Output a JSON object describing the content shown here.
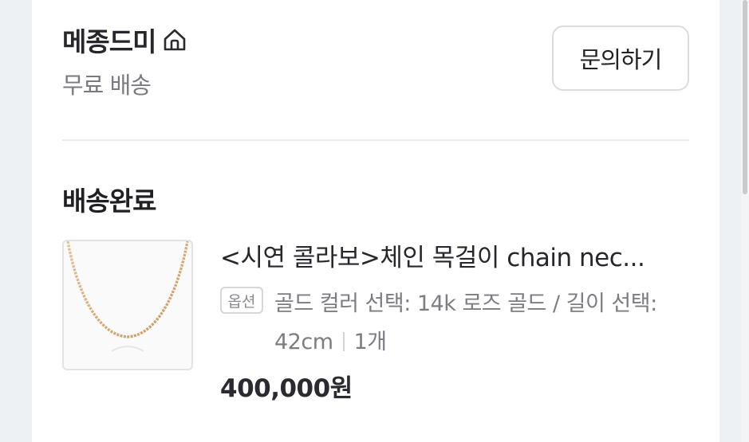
{
  "store": {
    "name": "메종드미",
    "shipping_label": "무료 배송",
    "inquiry_button": "문의하기",
    "home_icon": "home-icon"
  },
  "order": {
    "status": "배송완료",
    "product": {
      "name": "<시연 콜라보>체인 목걸이 chain nec...",
      "option_badge": "옵션",
      "option_text": "골드 컬러 선택: 14k 로즈 골드 / 길이 선택: 42cm",
      "quantity": "1개",
      "price": "400,000원",
      "thumbnail_icon": "necklace-image"
    }
  },
  "colors": {
    "background": "#eef1f3",
    "card": "#ffffff",
    "text_primary": "#1f1f24",
    "text_secondary": "#7a7a80",
    "necklace_gold": "#d2a874"
  }
}
